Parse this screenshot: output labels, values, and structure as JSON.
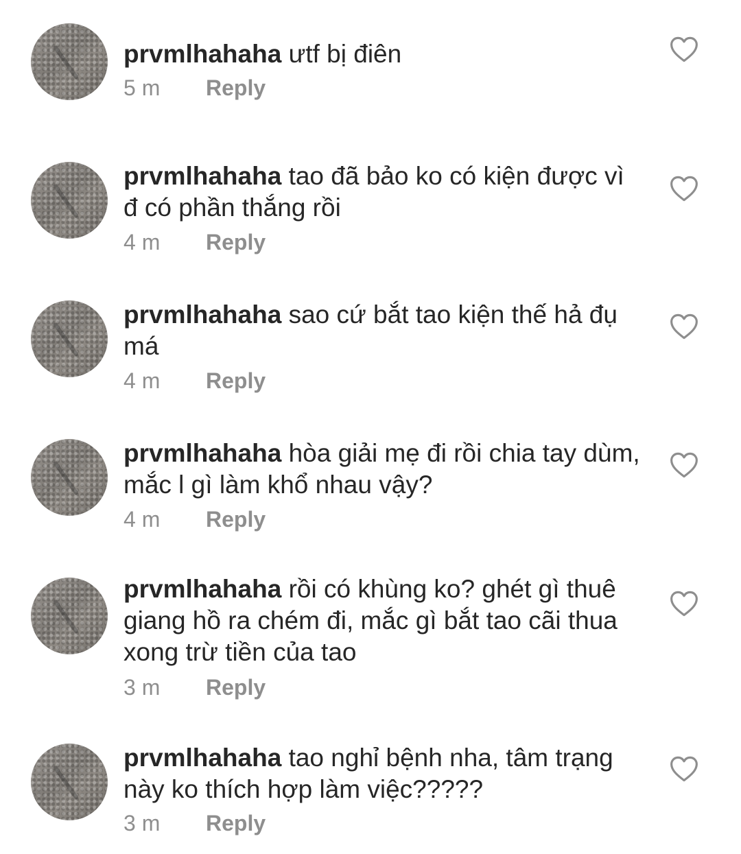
{
  "comments": [
    {
      "username": "prvmlhahaha",
      "text": "ưtf bị điên",
      "time": "5 m",
      "reply": "Reply",
      "icon": "heart-outline-icon"
    },
    {
      "username": "prvmlhahaha",
      "text": "tao đã bảo ko có kiện được vì đ có phần thắng rồi",
      "time": "4 m",
      "reply": "Reply",
      "icon": "heart-outline-icon"
    },
    {
      "username": "prvmlhahaha",
      "text": "sao cứ bắt tao kiện thế hả đụ má",
      "time": "4 m",
      "reply": "Reply",
      "icon": "heart-outline-icon"
    },
    {
      "username": "prvmlhahaha",
      "text": "hòa giải mẹ đi rồi chia tay dùm, mắc l gì làm khổ nhau vậy?",
      "time": "4 m",
      "reply": "Reply",
      "icon": "heart-outline-icon"
    },
    {
      "username": "prvmlhahaha",
      "text": "rồi có khùng ko? ghét gì thuê giang hồ ra chém đi, mắc gì bắt tao cãi thua xong trừ tiền của tao",
      "time": "3 m",
      "reply": "Reply",
      "icon": "heart-outline-icon"
    },
    {
      "username": "prvmlhahaha",
      "text": "tao nghỉ bệnh nha, tâm trạng này ko thích hợp làm việc?????",
      "time": "3 m",
      "reply": "Reply",
      "icon": "heart-outline-icon"
    }
  ]
}
